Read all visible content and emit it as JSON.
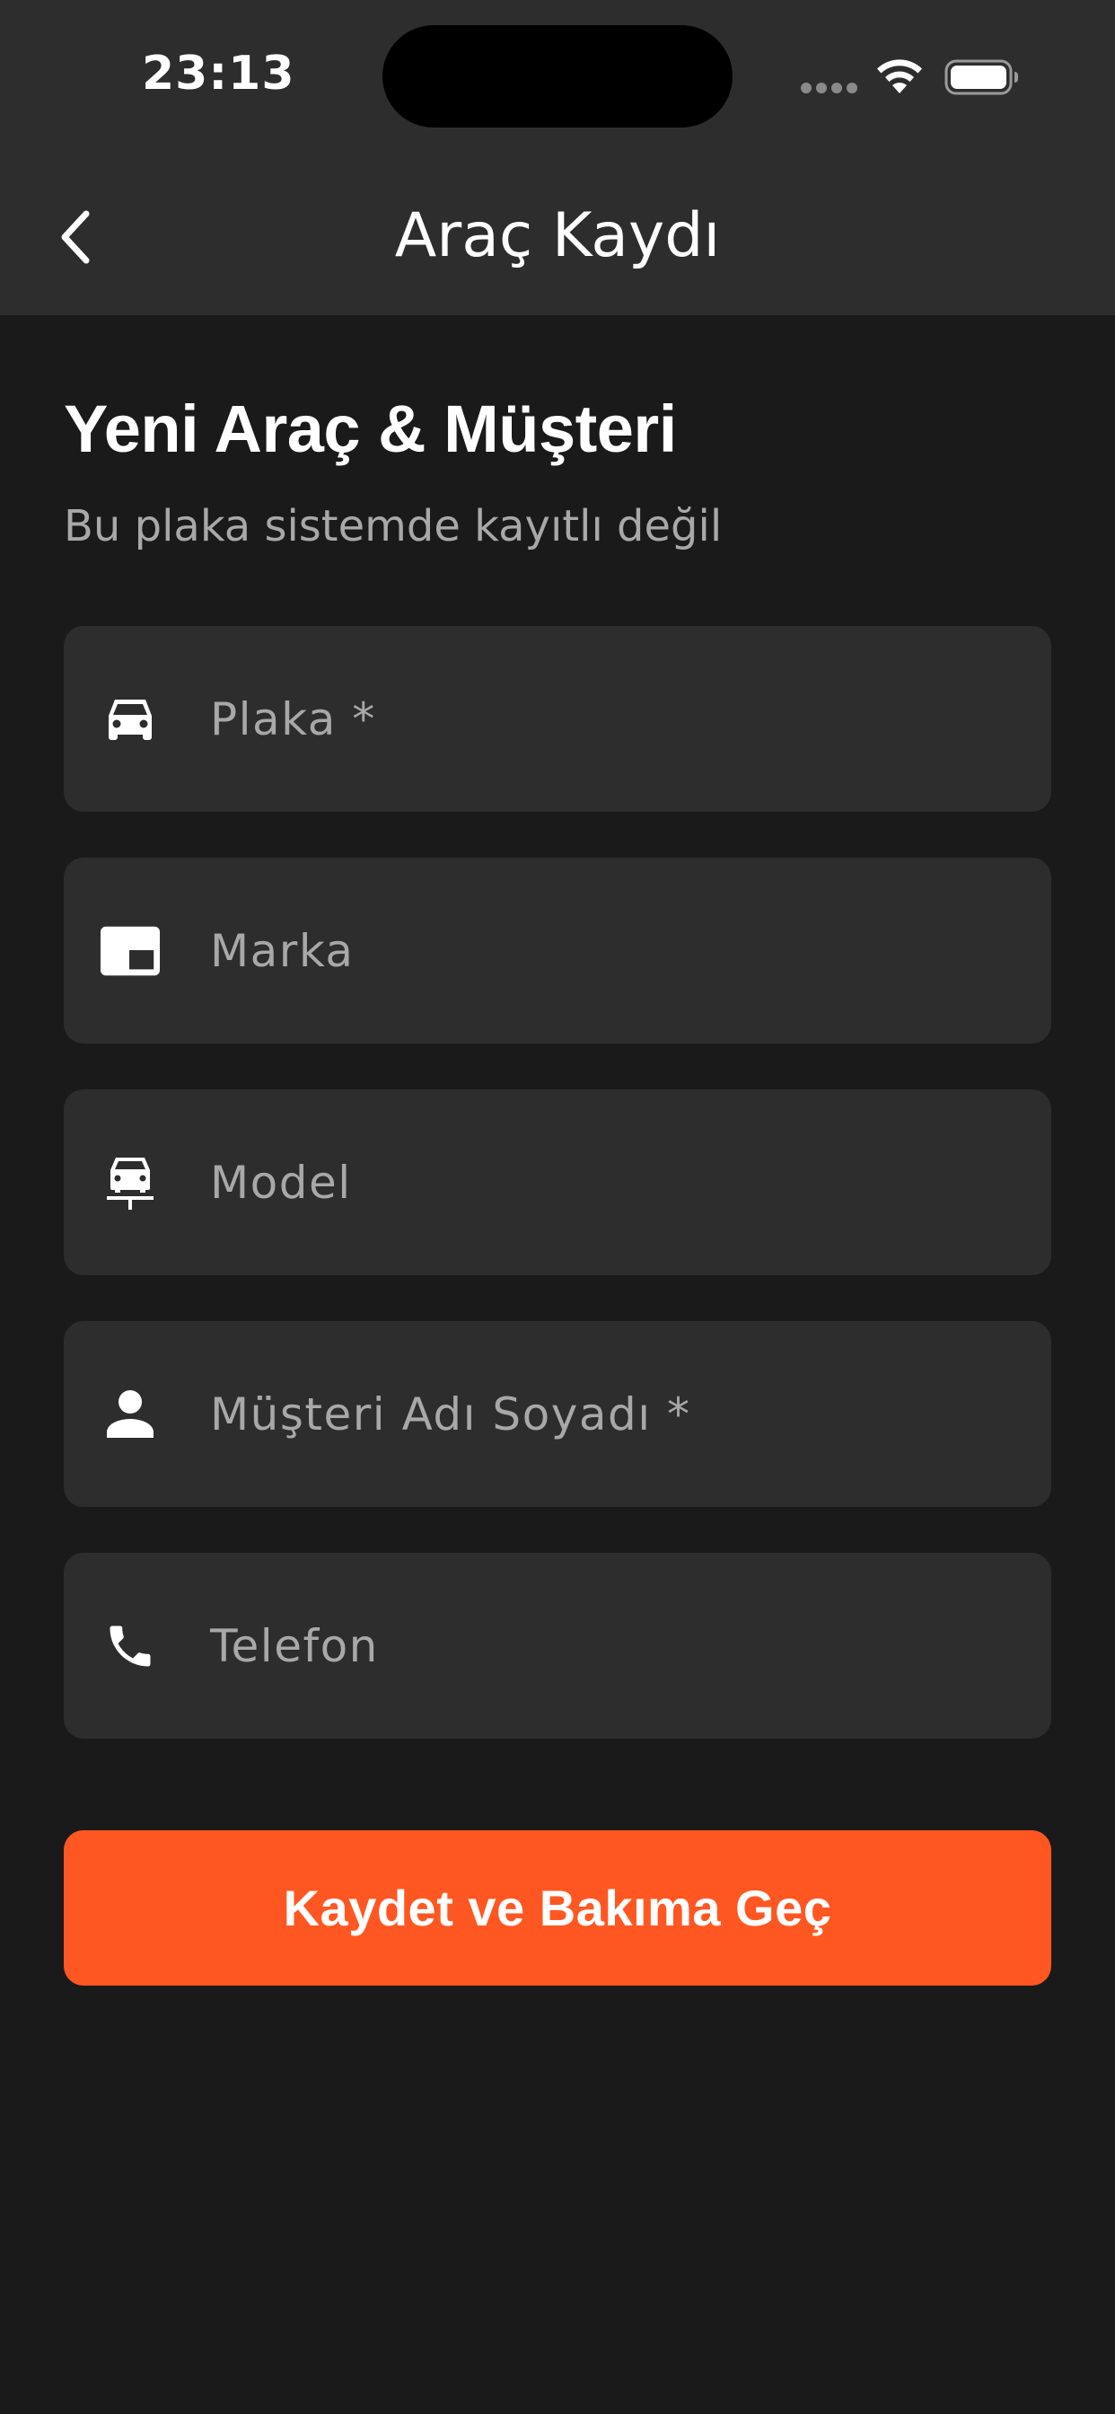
{
  "status_bar": {
    "time": "23:13"
  },
  "nav": {
    "title": "Araç Kaydı",
    "back_icon": "chevron-left-icon"
  },
  "form": {
    "heading": "Yeni Araç & Müşteri",
    "subheading": "Bu plaka sistemde kayıtlı değil",
    "fields": [
      {
        "icon": "car-icon",
        "placeholder": "Plaka *",
        "value": ""
      },
      {
        "icon": "brand-icon",
        "placeholder": "Marka",
        "value": ""
      },
      {
        "icon": "car-model-icon",
        "placeholder": "Model",
        "value": ""
      },
      {
        "icon": "person-icon",
        "placeholder": "Müşteri Adı Soyadı *",
        "value": ""
      },
      {
        "icon": "phone-icon",
        "placeholder": "Telefon",
        "value": ""
      }
    ],
    "submit_label": "Kaydet ve Bakıma Geç"
  },
  "colors": {
    "background": "#1a1a1a",
    "surface": "#2d2d2d",
    "accent": "#ff5722",
    "text_primary": "#ffffff",
    "text_secondary": "#a8a8a8"
  }
}
